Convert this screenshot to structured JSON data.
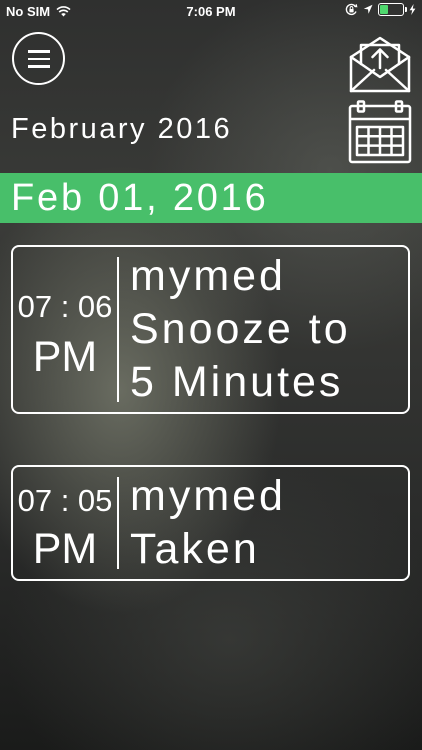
{
  "status_bar": {
    "carrier": "No SIM",
    "time": "7:06 PM",
    "battery_level": 0.35,
    "battery_color": "#4fd86e",
    "icons": [
      "wifi-icon",
      "orientation-lock-icon",
      "location-arrow-icon",
      "battery-icon",
      "charging-bolt-icon"
    ]
  },
  "header": {
    "menu_icon": "hamburger-menu-icon",
    "month_title": "February 2016",
    "share_icon": "envelope-upload-icon",
    "calendar_icon": "calendar-icon"
  },
  "date_banner": {
    "text": "Feb 01, 2016",
    "color": "#48bf6a"
  },
  "entries": [
    {
      "time": "07 : 06",
      "ampm": "PM",
      "lines": [
        "mymed",
        "Snooze to",
        "5 Minutes"
      ]
    },
    {
      "time": "07 : 05",
      "ampm": "PM",
      "lines": [
        "mymed",
        "Taken"
      ]
    }
  ]
}
